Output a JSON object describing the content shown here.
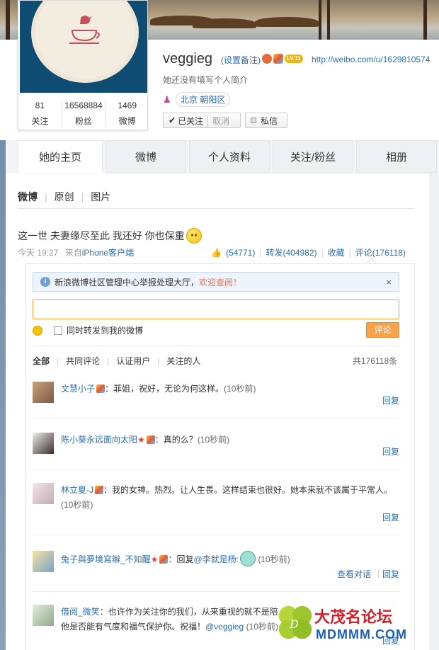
{
  "profile": {
    "username": "veggieg",
    "remark": "(设置备注)",
    "level": "LV.11",
    "url": "http://weibo.com/u/1629810574",
    "intro": "她还没有填写个人简介",
    "location": "北京 朝阳区",
    "stats": [
      {
        "num": "81",
        "label": "关注"
      },
      {
        "num": "16568884",
        "label": "粉丝"
      },
      {
        "num": "1469",
        "label": "微博"
      }
    ],
    "followed_label": "已关注",
    "cancel_label": "取消",
    "message_label": "私信"
  },
  "tabs": [
    {
      "label": "她的主页",
      "active": true
    },
    {
      "label": "微博",
      "active": false
    },
    {
      "label": "个人资料",
      "active": false
    },
    {
      "label": "关注/粉丝",
      "active": false
    },
    {
      "label": "相册",
      "active": false
    }
  ],
  "subnav": [
    "微博",
    "原创",
    "图片"
  ],
  "post": {
    "text": "这一世 夫妻缘尽至此 我还好 你也保重",
    "time": "今天 19:27",
    "source_prefix": "来自",
    "source": "iPhone客户端",
    "likes": "(54771)",
    "repost": "转发(404982)",
    "favorite": "收藏",
    "comment": "评论(176118)"
  },
  "notice": {
    "text": "新浪微博社区管理中心举报处理大厅，",
    "link": "欢迎查阅！",
    "close": "×"
  },
  "composer": {
    "also_repost": "同时转发到我的微博",
    "submit": "评论"
  },
  "filters": [
    "全部",
    "共同评论",
    "认证用户",
    "关注的人"
  ],
  "total": "共176118条",
  "comments": [
    {
      "name": "文慧小子",
      "body": "：菲姐，祝好，无论为何这样。",
      "time": "(10秒前)",
      "reply": "回复"
    },
    {
      "name": "陈小葵永远面向太阳",
      "body": "：真的么？",
      "time": "(10秒前)",
      "reply": "回复"
    },
    {
      "name": "林立夏-J",
      "body": "：我的女神。热烈。让人生畏。这样结束也很好。她本来就不该属于平常人。",
      "time": "(10秒前)",
      "reply": "回复"
    },
    {
      "name": "兔子與夢境寫辮_不知醒",
      "body_pre": "：回复",
      "at": "@李就是杨:",
      "time": "(10秒前)",
      "conv": "查看对话",
      "reply": "回复"
    },
    {
      "name": "借阅_微笑",
      "body": "：也许作为关注你的我们，从来重视的就不是陪",
      "body2_pre": "他是否能有气度和福气保护你。祝福！",
      "at": "@veggieg",
      "time": "(10秒前)",
      "reply": "回复"
    }
  ],
  "watermark": {
    "title": "大茂名论坛",
    "site": "MDMMM.COM"
  }
}
